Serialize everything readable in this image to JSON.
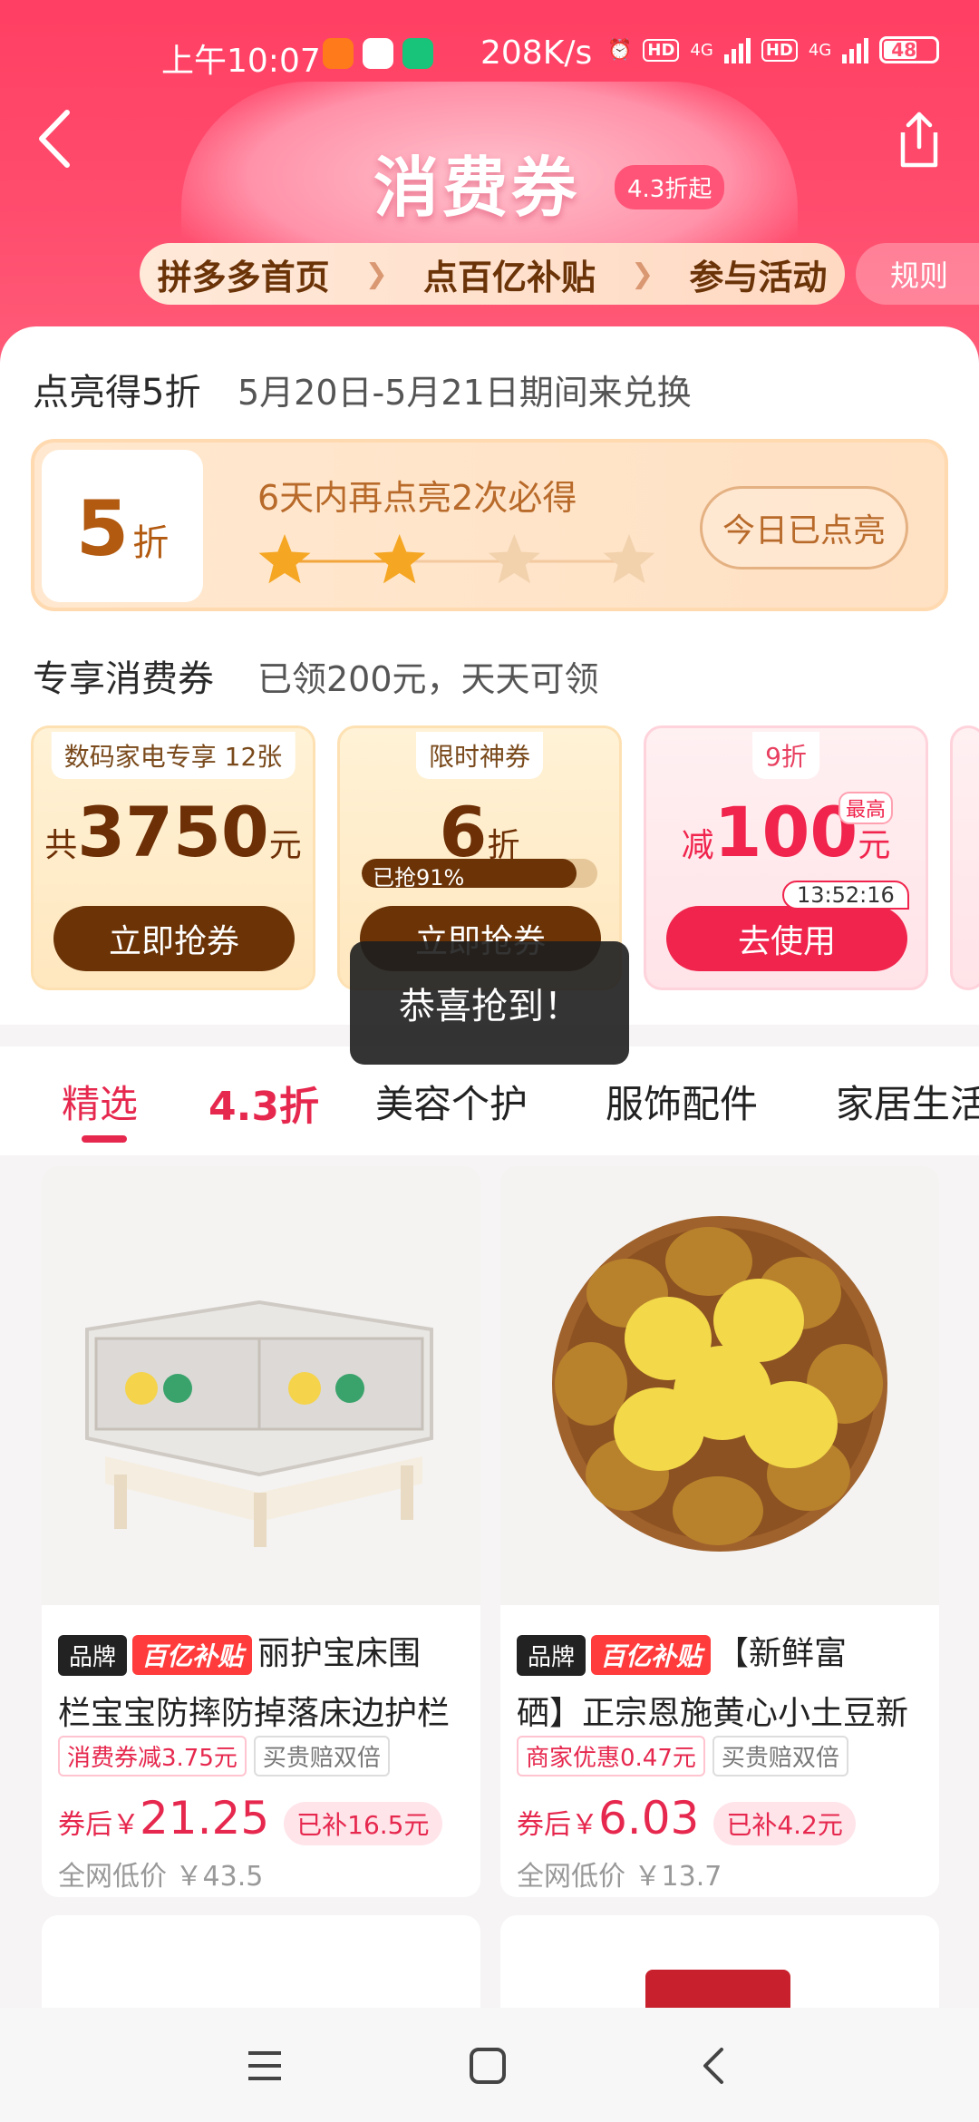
{
  "status": {
    "time": "上午10:07",
    "net_speed": "208K/s",
    "network_type_1": "4G",
    "network_type_2": "4G",
    "battery": "48"
  },
  "header": {
    "title": "消费券",
    "badge": "4.3折起",
    "steps": [
      "拼多多首页",
      "点百亿补贴",
      "参与活动"
    ],
    "rules_label": "规则"
  },
  "light_up": {
    "title": "点亮得5折",
    "subtitle": "5月20日-5月21日期间来兑换",
    "discount_num": "5",
    "discount_unit": "折",
    "message": "6天内再点亮2次必得",
    "stars_lit": 2,
    "stars_total": 4,
    "button_label": "今日已点亮"
  },
  "coupons_section": {
    "title": "专享消费券",
    "subtitle": "已领200元，天天可领",
    "coupons": [
      {
        "tag": "数码家电专享 12张",
        "prefix": "共",
        "amount": "3750",
        "unit": "元",
        "button": "立即抢券"
      },
      {
        "tag": "限时神券",
        "prefix": "",
        "amount": "6",
        "unit": "折",
        "progress_label": "已抢91%",
        "progress": 0.91,
        "button": "立即抢券"
      },
      {
        "tag": "9折",
        "prefix": "减",
        "amount": "100",
        "unit": "元",
        "max_label": "最高",
        "timer": "13:52:16",
        "button": "去使用"
      }
    ]
  },
  "toast": "恭喜抢到！",
  "tabs": [
    "精选",
    "4.3折",
    "美容个护",
    "服饰配件",
    "家居生活"
  ],
  "products": [
    {
      "brand": "品牌",
      "subsidy_logo": "百亿补贴",
      "title_line1": "丽护宝床围",
      "title_line2": "栏宝宝防摔防掉落床边护栏",
      "tags": [
        "消费券减3.75元",
        "买贵赔双倍"
      ],
      "price_prefix": "券后￥",
      "price": "21.25",
      "subsidy": "已补16.5元",
      "low_price": "全网低价 ￥43.5"
    },
    {
      "brand": "品牌",
      "subsidy_logo": "百亿补贴",
      "title_line1": "【新鲜富",
      "title_line2": "硒】正宗恩施黄心小土豆新",
      "tags": [
        "商家优惠0.47元",
        "买贵赔双倍"
      ],
      "price_prefix": "券后￥",
      "price": "6.03",
      "subsidy": "已补4.2元",
      "low_price": "全网低价 ￥13.7"
    }
  ],
  "icons": {
    "back": "back-icon",
    "share": "share-icon",
    "nav": [
      "menu-icon",
      "home-icon",
      "back-nav-icon"
    ]
  },
  "colors": {
    "primary": "#ff4d6e",
    "accent_red": "#e6284e",
    "coupon_brown": "#6b3306"
  }
}
